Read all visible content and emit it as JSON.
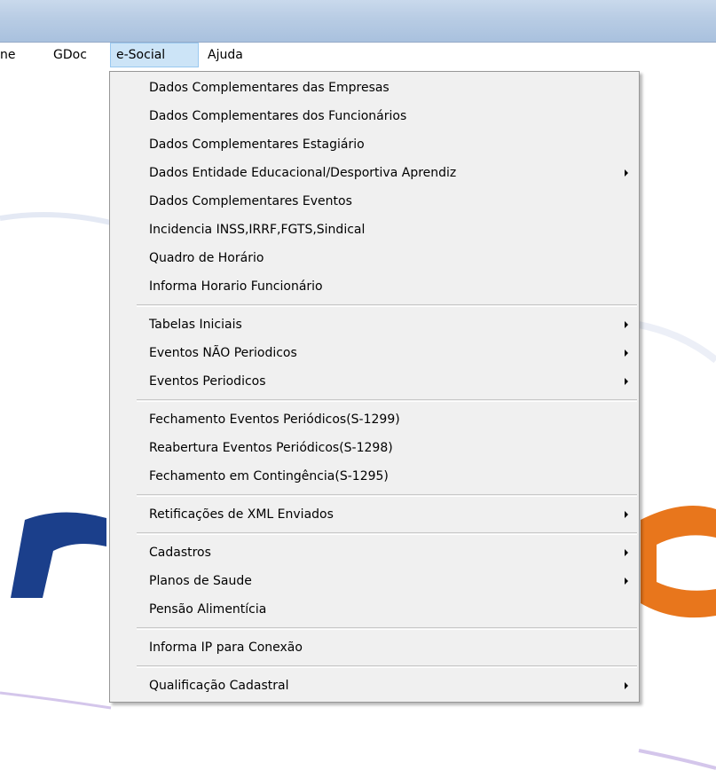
{
  "menubar": {
    "items": [
      {
        "label": "ne"
      },
      {
        "label": "GDoc"
      },
      {
        "label": "e-Social"
      },
      {
        "label": "Ajuda"
      }
    ]
  },
  "menu": {
    "items": [
      {
        "label": "Dados Complementares das Empresas",
        "submenu": false
      },
      {
        "label": "Dados Complementares dos Funcionários",
        "submenu": false
      },
      {
        "label": "Dados Complementares Estagiário",
        "submenu": false
      },
      {
        "label": "Dados Entidade Educacional/Desportiva Aprendiz",
        "submenu": true
      },
      {
        "label": "Dados Complementares Eventos",
        "submenu": false
      },
      {
        "label": "Incidencia INSS,IRRF,FGTS,Sindical",
        "submenu": false
      },
      {
        "label": "Quadro de Horário",
        "submenu": false
      },
      {
        "label": "Informa Horario Funcionário",
        "submenu": false
      },
      {
        "label": "Tabelas Iniciais",
        "submenu": true
      },
      {
        "label": "Eventos NÃO Periodicos",
        "submenu": true
      },
      {
        "label": "Eventos Periodicos",
        "submenu": true
      },
      {
        "label": "Fechamento Eventos Periódicos(S-1299)",
        "submenu": false
      },
      {
        "label": "Reabertura Eventos Periódicos(S-1298)",
        "submenu": false
      },
      {
        "label": "Fechamento em Contingência(S-1295)",
        "submenu": false
      },
      {
        "label": "Retificações de XML Enviados",
        "submenu": true
      },
      {
        "label": "Cadastros",
        "submenu": true
      },
      {
        "label": "Planos de Saude",
        "submenu": true
      },
      {
        "label": "Pensão Alimentícia",
        "submenu": false
      },
      {
        "label": "Informa IP para Conexão",
        "submenu": false
      },
      {
        "label": "Qualificação Cadastral",
        "submenu": true
      }
    ]
  },
  "colors": {
    "logo_blue": "#1b3f8b",
    "logo_orange": "#e8761c",
    "menu_background": "#f0f0f0",
    "menubar_highlight": "#cce4f7"
  }
}
